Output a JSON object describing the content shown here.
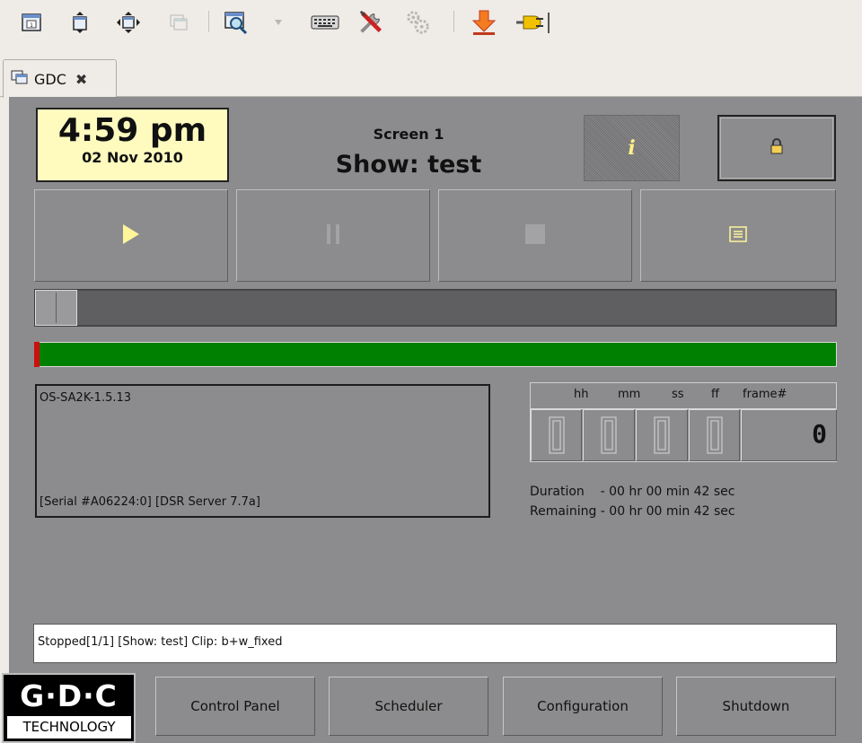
{
  "toolbar": {
    "icons": [
      "window-icon",
      "maximize-icon",
      "move-icon",
      "windows-icon",
      "magnifier-icon",
      "dropdown-arrow-icon",
      "keyboard-icon",
      "tools-icon",
      "gears-icon",
      "download-icon",
      "plug-icon"
    ]
  },
  "tab": {
    "label": "GDC",
    "close_glyph": "✖"
  },
  "clock": {
    "time": "4:59 pm",
    "date": "02 Nov 2010"
  },
  "screen": {
    "label": "Screen 1",
    "show": "Show: test"
  },
  "controls": {
    "info_glyph": "i"
  },
  "progress": {
    "position_fraction": 0.0
  },
  "info_box": {
    "version": "OS-SA2K-1.5.13",
    "serial": "[Serial #A06224:0] [DSR Server 7.7a]"
  },
  "timecode": {
    "headers": {
      "hh": "hh",
      "mm": "mm",
      "ss": "ss",
      "ff": "ff",
      "frame": "frame#"
    },
    "digits": {
      "hh": "0",
      "mm": "0",
      "ss": "0",
      "ff": "0"
    },
    "frame": "0"
  },
  "duration": "Duration    - 00 hr 00 min 42 sec",
  "remaining": "Remaining - 00 hr 00 min 42 sec",
  "status": "Stopped[1/1] [Show: test] Clip: b+w_fixed",
  "logo": {
    "brand": "G·D·C",
    "tagline": "TECHNOLOGY"
  },
  "nav": {
    "control_panel": "Control Panel",
    "scheduler": "Scheduler",
    "configuration": "Configuration",
    "shutdown": "Shutdown"
  },
  "colors": {
    "panel_bg": "#8c8c8e",
    "clock_bg": "#fffbbf",
    "level_green": "#008000",
    "level_red": "#cc1010",
    "play_arrow": "#fff59a"
  }
}
